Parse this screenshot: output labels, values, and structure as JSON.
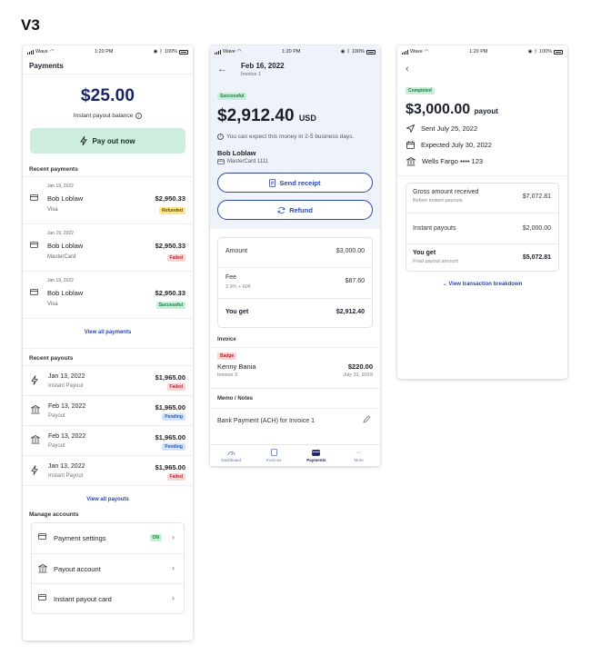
{
  "version_label": "V3",
  "status": {
    "carrier": "Wave",
    "time": "1:20 PM",
    "battery": "100%"
  },
  "payments_screen": {
    "title": "Payments",
    "balance": "$25.00",
    "balance_label": "Instant payout balance",
    "payout_button": "Pay out now",
    "recent_payments_label": "Recent payments",
    "recent_payments": [
      {
        "date": "Jan 19, 2022",
        "name": "Bob Loblaw",
        "card": "Visa",
        "amount": "$2,950.33",
        "status": "Refunded"
      },
      {
        "date": "Jan 19, 2022",
        "name": "Bob Loblaw",
        "card": "MasterCard",
        "amount": "$2,950.33",
        "status": "Failed"
      },
      {
        "date": "Jan 19, 2022",
        "name": "Bob Loblaw",
        "card": "Visa",
        "amount": "$2,950.33",
        "status": "Successful"
      }
    ],
    "view_all_payments": "View all payments",
    "recent_payouts_label": "Recent payouts",
    "recent_payouts": [
      {
        "date": "Jan 13, 2022",
        "type": "Instant Payout",
        "amount": "$1,965.00",
        "status": "Failed",
        "icon": "bolt-icon"
      },
      {
        "date": "Feb 13, 2022",
        "type": "Payout",
        "amount": "$1,965.00",
        "status": "Pending",
        "icon": "bank-icon"
      },
      {
        "date": "Feb 13, 2022",
        "type": "Payout",
        "amount": "$1,965.00",
        "status": "Pending",
        "icon": "bank-icon"
      },
      {
        "date": "Jan 13, 2022",
        "type": "Instant Payout",
        "amount": "$1,965.00",
        "status": "Failed",
        "icon": "bolt-icon"
      }
    ],
    "view_all_payouts": "View all payouts",
    "manage_label": "Manage accounts",
    "manage_items": [
      {
        "label": "Payment settings",
        "badge": "ON"
      },
      {
        "label": "Payout account"
      },
      {
        "label": "Instant payout card"
      }
    ]
  },
  "detail_screen": {
    "date": "Feb 16, 2022",
    "invoice_ref": "Invoice 1",
    "status": "Successful",
    "amount": "$2,912.40",
    "currency": "USD",
    "expect_text": "You can expect this money in 2-5 business days.",
    "customer": "Bob Loblaw",
    "card": "MasterCard 1111",
    "send_receipt": "Send receipt",
    "refund": "Refund",
    "breakdown": {
      "amount_label": "Amount",
      "amount_value": "$3,000.00",
      "fee_label": "Fee",
      "fee_sub": "2.9% + 60¢",
      "fee_value": "$87.60",
      "get_label": "You get",
      "get_value": "$2,912.40"
    },
    "invoice_label": "Invoice",
    "invoice": {
      "badge": "Badge",
      "name": "Kenny Bania",
      "number": "Invoice 3",
      "amount": "$220.00",
      "date": "July 31, 2019"
    },
    "memo_label": "Memo / Notes",
    "memo_text": "Bank Payment (ACH) for Invoice 1",
    "tabs": [
      "Dashboard",
      "Invoices",
      "Payments",
      "More"
    ]
  },
  "payout_screen": {
    "status": "Completed",
    "amount": "$3,000.00",
    "amount_suffix": "payout",
    "sent": "Sent July 25, 2022",
    "expected": "Expected July 30, 2022",
    "bank": "Wells Fargo •••• 123",
    "gross_label": "Gross amount received",
    "gross_sub": "Before instant payouts",
    "gross_value": "$7,072.81",
    "instant_label": "Instant payouts",
    "instant_value": "$2,000.00",
    "get_label": "You get",
    "get_sub": "Final payout amount",
    "get_value": "$5,072.81",
    "breakdown_link": "View transaction breakdown"
  }
}
